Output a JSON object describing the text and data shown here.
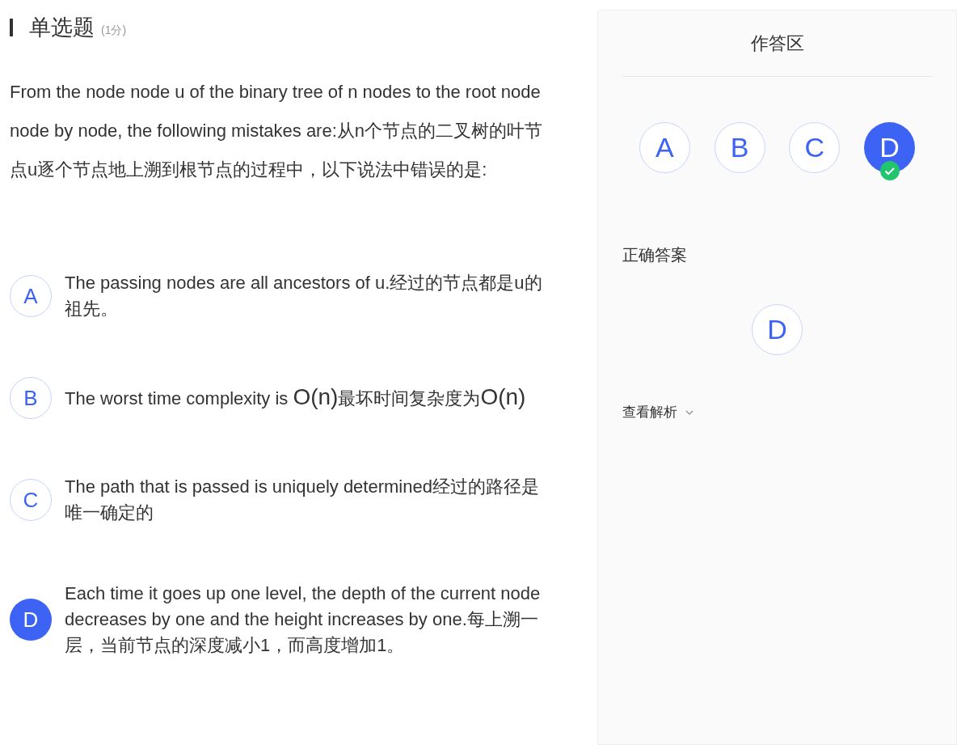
{
  "question": {
    "type_label": "单选题",
    "score": "(1分)",
    "text": "From the node node u of the binary tree of n nodes to the root node node by node, the following mistakes are:从n个节点的二叉树的叶节点u逐个节点地上溯到根节点的过程中，以下说法中错误的是:"
  },
  "options": [
    {
      "letter": "A",
      "selected": false,
      "parts": [
        {
          "kind": "plain",
          "text": "The passing nodes are all ancestors of u.经过的节点都是u的祖先。"
        }
      ]
    },
    {
      "letter": "B",
      "selected": false,
      "parts": [
        {
          "kind": "plain",
          "text": "The worst time complexity is "
        },
        {
          "kind": "math",
          "text": "O(n)"
        },
        {
          "kind": "plain",
          "text": "最坏时间复杂度为"
        },
        {
          "kind": "math",
          "text": "O(n)"
        }
      ]
    },
    {
      "letter": "C",
      "selected": false,
      "parts": [
        {
          "kind": "plain",
          "text": "The path that is passed is uniquely determined经过的路径是唯一确定的"
        }
      ]
    },
    {
      "letter": "D",
      "selected": true,
      "parts": [
        {
          "kind": "plain",
          "text": "Each time it goes up one level, the depth of the current node decreases by one and the height increases by one.每上溯一层，当前节点的深度减小1，而高度增加1。"
        }
      ]
    }
  ],
  "answer_panel": {
    "title": "作答区",
    "choices": [
      {
        "letter": "A",
        "selected": false,
        "correct": false
      },
      {
        "letter": "B",
        "selected": false,
        "correct": false
      },
      {
        "letter": "C",
        "selected": false,
        "correct": false
      },
      {
        "letter": "D",
        "selected": true,
        "correct": true
      }
    ],
    "correct_answer_label": "正确答案",
    "correct_answer": "D",
    "analysis_link": "查看解析"
  }
}
